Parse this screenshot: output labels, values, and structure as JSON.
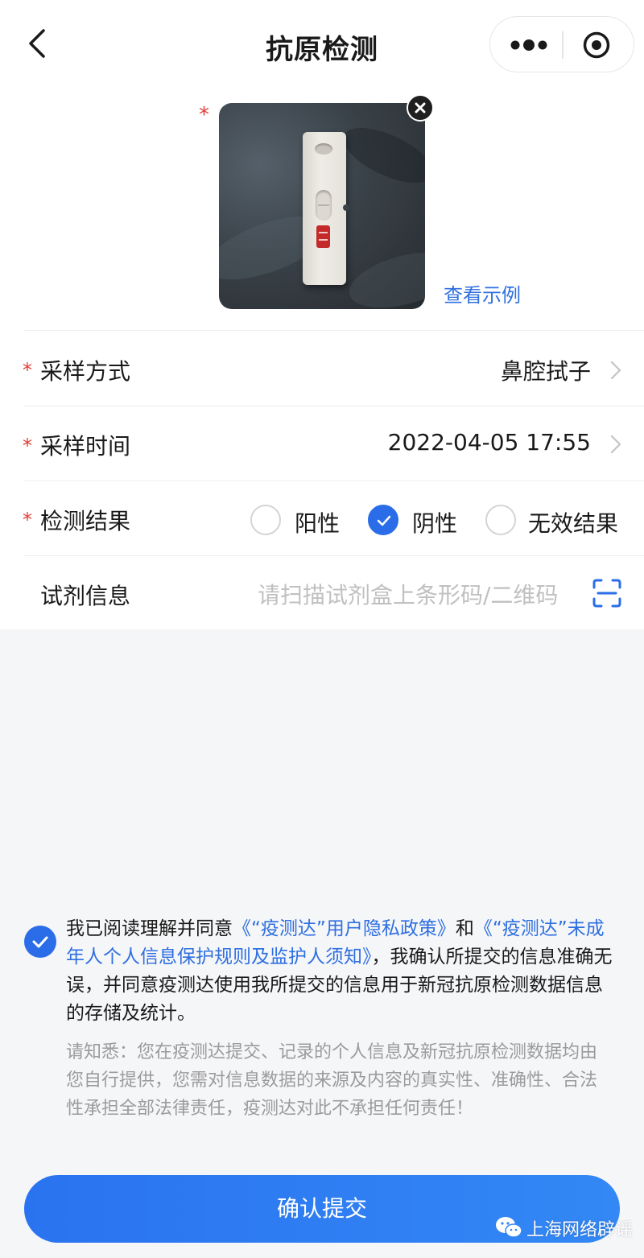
{
  "nav": {
    "title": "抗原检测"
  },
  "upload": {
    "required_mark": "*",
    "example_link": "查看示例"
  },
  "form": {
    "sampling_method": {
      "required_mark": "*",
      "label": "采样方式",
      "value": "鼻腔拭子"
    },
    "sampling_time": {
      "required_mark": "*",
      "label": "采样时间",
      "value": "2022-04-05 17:55"
    },
    "result": {
      "required_mark": "*",
      "label": "检测结果",
      "options": [
        {
          "label": "阳性",
          "checked": false
        },
        {
          "label": "阴性",
          "checked": true
        },
        {
          "label": "无效结果",
          "checked": false
        }
      ]
    },
    "reagent": {
      "label": "试剂信息",
      "placeholder": "请扫描试剂盒上条形码/二维码"
    }
  },
  "agreement": {
    "checked": true,
    "text_1": "我已阅读理解并同意",
    "link_1": "《“疫测达”用户隐私政策》",
    "text_2": "和",
    "link_2": "《“疫测达”未成年人个人信息保护规则及监护人须知》",
    "text_3": "，我确认所提交的信息准确无误，并同意疫测达使用我所提交的信息用于新冠抗原检测数据信息的存储及统计。",
    "notice": "请知悉：您在疫测达提交、记录的个人信息及新冠抗原检测数据均由您自行提供，您需对信息数据的来源及内容的真实性、准确性、合法性承担全部法律责任，疫测达对此不承担任何责任！"
  },
  "submit": {
    "label": "确认提交"
  },
  "watermark": {
    "text": "上海网络辟谣"
  },
  "colors": {
    "accent": "#2b6de8",
    "link": "#2f6fe0",
    "required": "#e0403a"
  }
}
